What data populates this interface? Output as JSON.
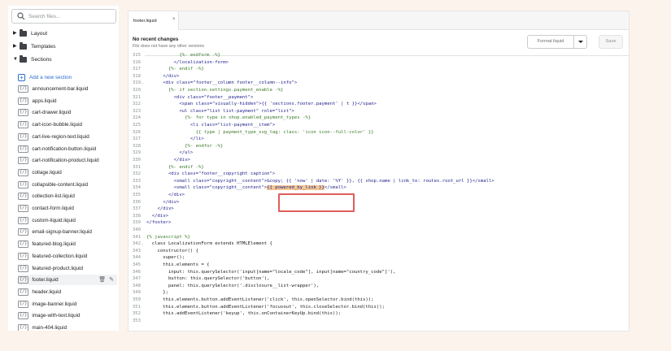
{
  "sidebar": {
    "search_placeholder": "Search files...",
    "folders": [
      {
        "label": "Layout",
        "expanded": false
      },
      {
        "label": "Templates",
        "expanded": false
      },
      {
        "label": "Sections",
        "expanded": true
      }
    ],
    "add_new_label": "Add a new section",
    "file_icon_text": "{/}",
    "files": [
      "announcement-bar.liquid",
      "apps.liquid",
      "cart-drawer.liquid",
      "cart-icon-bubble.liquid",
      "cart-live-region-text.liquid",
      "cart-notification-button.liquid",
      "cart-notification-product.liquid",
      "collage.liquid",
      "collapsible-content.liquid",
      "collection-list.liquid",
      "contact-form.liquid",
      "custom-liquid.liquid",
      "email-signup-banner.liquid",
      "featured-blog.liquid",
      "featured-collection.liquid",
      "featured-product.liquid",
      "footer.liquid",
      "header.liquid",
      "image-banner.liquid",
      "image-with-text.liquid",
      "main-404.liquid"
    ],
    "active_file": "footer.liquid"
  },
  "editor": {
    "tab_label": "footer.liquid",
    "tab_close": "×",
    "changes_title": "No recent changes",
    "changes_subtitle": "File does not have any other versions",
    "format_button": "Format liquid",
    "save_button": "Save",
    "highlighted_text": "{{ powered_by_link }}"
  },
  "code_lines": [
    {
      "n": "315",
      "t": "            {%- endform -%}"
    },
    {
      "n": "316",
      "t": "          </localization-form>"
    },
    {
      "n": "317",
      "t": "        {%- endif -%}"
    },
    {
      "n": "318",
      "t": "      </div>"
    },
    {
      "n": "319",
      "t": "      <div class=\"footer__column footer__column--info\">"
    },
    {
      "n": "320",
      "t": "        {%- if section.settings.payment_enable -%}"
    },
    {
      "n": "321",
      "t": "          <div class=\"footer__payment\">"
    },
    {
      "n": "322",
      "t": "            <span class=\"visually-hidden\">{{ 'sections.footer.payment' | t }}</span>"
    },
    {
      "n": "323",
      "t": "            <ul class=\"list list-payment\" role=\"list\">"
    },
    {
      "n": "324",
      "t": "              {%- for type in shop.enabled_payment_types -%}"
    },
    {
      "n": "325",
      "t": "                <li class=\"list-payment__item\">"
    },
    {
      "n": "326",
      "t": "                  {{ type | payment_type_svg_tag: class: 'icon icon--full-color' }}"
    },
    {
      "n": "327",
      "t": "                </li>"
    },
    {
      "n": "328",
      "t": "              {%- endfor -%}"
    },
    {
      "n": "329",
      "t": "            </ul>"
    },
    {
      "n": "330",
      "t": "          </div>"
    },
    {
      "n": "331",
      "t": "        {%- endif -%}"
    },
    {
      "n": "332",
      "t": "        <div class=\"footer__copyright caption\">"
    },
    {
      "n": "333",
      "t": "          <small class=\"copyright__content\">&copy; {{ 'now' | date: '%Y' }}, {{ shop.name | link_to: routes.root_url }}</small>"
    },
    {
      "n": "334",
      "t": "          <small class=\"copyright__content\">{{ powered_by_link }}</small>"
    },
    {
      "n": "335",
      "t": "        </div>"
    },
    {
      "n": "336",
      "t": "      </div>"
    },
    {
      "n": "337",
      "t": "    </div>"
    },
    {
      "n": "338",
      "t": "  </div>"
    },
    {
      "n": "339",
      "t": "</footer>"
    },
    {
      "n": "340",
      "t": ""
    },
    {
      "n": "341",
      "t": "{% javascript %}"
    },
    {
      "n": "342",
      "t": "  class LocalizationForm extends HTMLElement {"
    },
    {
      "n": "343",
      "t": "    constructor() {"
    },
    {
      "n": "344",
      "t": "      super();"
    },
    {
      "n": "345",
      "t": "      this.elements = {"
    },
    {
      "n": "346",
      "t": "        input: this.querySelector('input[name=\"locale_code\"], input[name=\"country_code\"]'),"
    },
    {
      "n": "347",
      "t": "        button: this.querySelector('button'),"
    },
    {
      "n": "348",
      "t": "        panel: this.querySelector('.disclosure__list-wrapper'),"
    },
    {
      "n": "349",
      "t": "      };"
    },
    {
      "n": "350",
      "t": "      this.elements.button.addEventListener('click', this.openSelector.bind(this));"
    },
    {
      "n": "351",
      "t": "      this.elements.button.addEventListener('focusout', this.closeSelector.bind(this));"
    },
    {
      "n": "352",
      "t": "      this.addEventListener('keyup', this.onContainerKeyUp.bind(this));"
    },
    {
      "n": "353",
      "t": ""
    }
  ],
  "fold_lines": [
    "319",
    "342"
  ]
}
